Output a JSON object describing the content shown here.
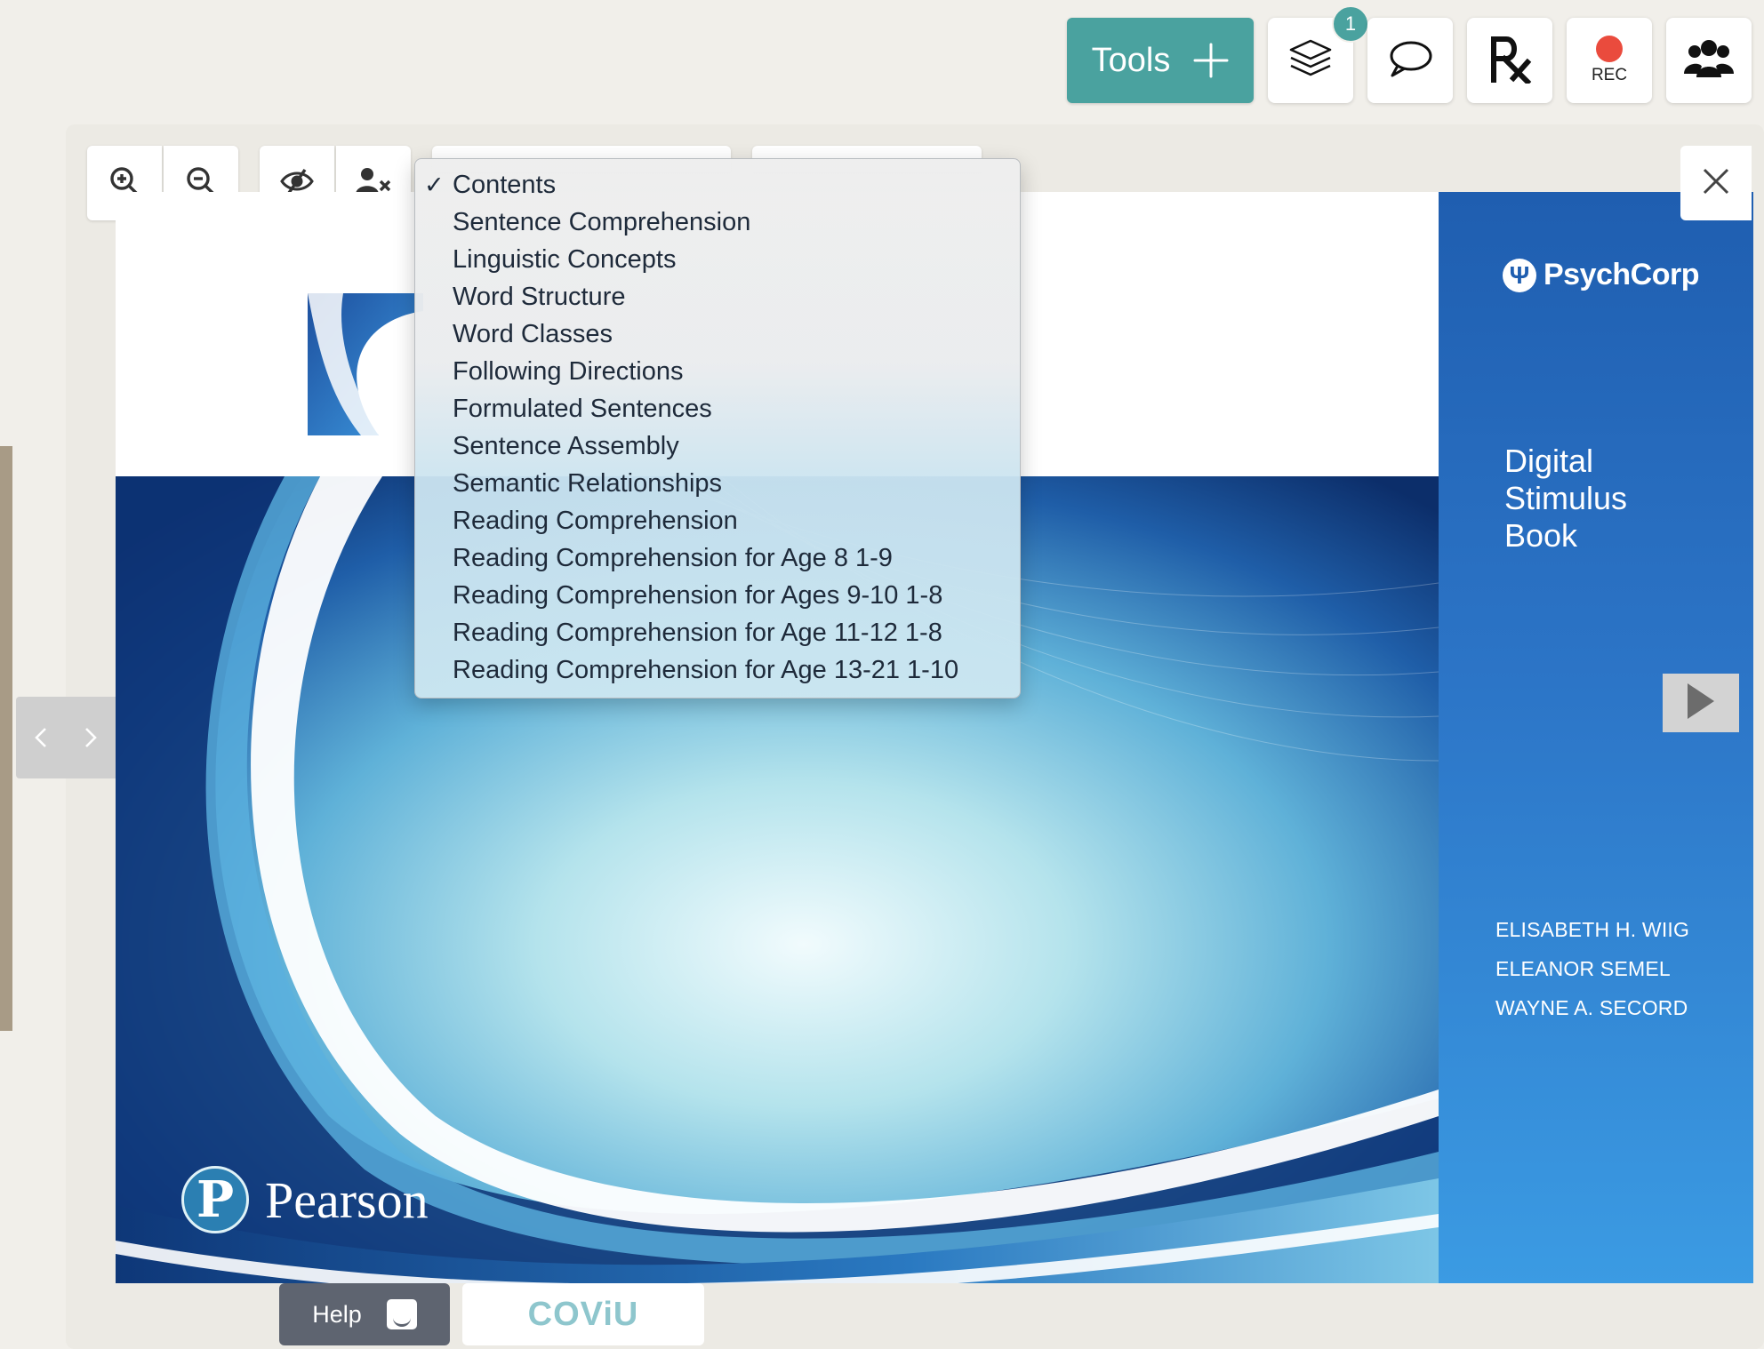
{
  "toolbar": {
    "tools_label": "Tools",
    "layers_badge": "1",
    "rec_label": "REC",
    "accent_color": "#4aa29f",
    "rec_color": "#ea4b3d",
    "icons": [
      "plus-icon",
      "layers-icon",
      "chat-icon",
      "prescription-icon",
      "record-icon",
      "participants-icon"
    ]
  },
  "viewer": {
    "tools": [
      "zoom-in-icon",
      "zoom-out-icon",
      "hide-view-icon",
      "remove-user-icon",
      "close-icon"
    ],
    "navigation": {
      "prev_glyph": "‹",
      "next_glyph": "›",
      "next_page_icon": "play-icon"
    }
  },
  "contents_dropdown": {
    "selected": "Contents",
    "items": [
      {
        "label": "Contents",
        "checked": true
      },
      {
        "label": "Sentence Comprehension",
        "checked": false
      },
      {
        "label": "Linguistic Concepts",
        "checked": false
      },
      {
        "label": "Word Structure",
        "checked": false
      },
      {
        "label": "Word Classes",
        "checked": false
      },
      {
        "label": "Following Directions",
        "checked": false
      },
      {
        "label": "Formulated Sentences",
        "checked": false
      },
      {
        "label": "Sentence Assembly",
        "checked": false
      },
      {
        "label": "Semantic Relationships",
        "checked": false
      },
      {
        "label": "Reading Comprehension",
        "checked": false
      },
      {
        "label": "Reading Comprehension for Age 8 1-9",
        "checked": false
      },
      {
        "label": "Reading Comprehension for Ages 9-10 1-8",
        "checked": false
      },
      {
        "label": "Reading Comprehension for Age 11-12 1-8",
        "checked": false
      },
      {
        "label": "Reading Comprehension for Age 13-21 1-10",
        "checked": false
      }
    ]
  },
  "book": {
    "publisher_logo_text": "Pearson",
    "publisher_mark": "P",
    "brand_logo_text": "PsychCorp",
    "brand_mark": "Ψ",
    "title_lines": [
      "Digital",
      "Stimulus",
      "Book"
    ],
    "authors": [
      "ELISABETH H. WIIG",
      "ELEANOR SEMEL",
      "WAYNE A. SECORD"
    ],
    "cover_color": "#2c75c7"
  },
  "bottom_bar": {
    "help_label": "Help",
    "brand_label": "COViU"
  }
}
